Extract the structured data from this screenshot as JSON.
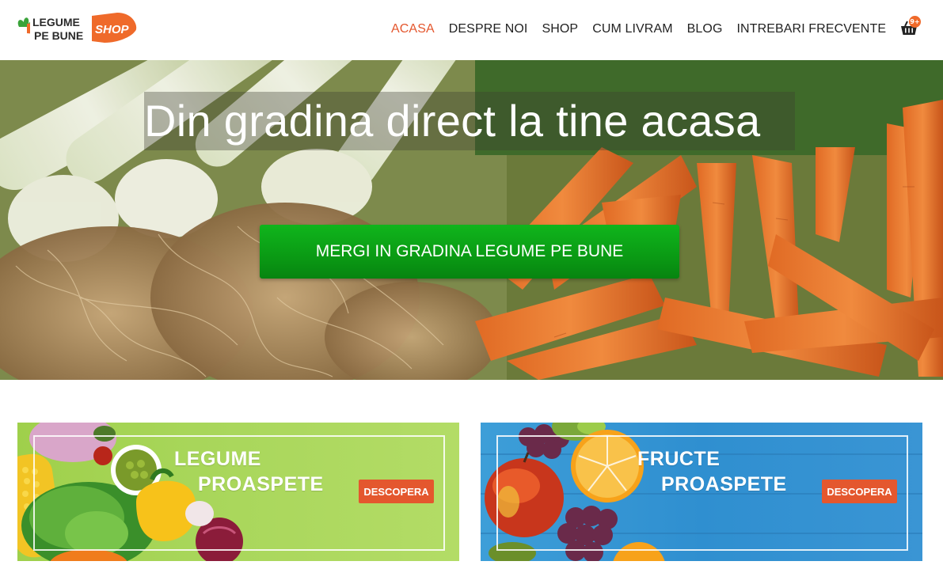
{
  "logo": {
    "line1": "LEGUME",
    "line2": "PE BUNE",
    "shop": "SHOP"
  },
  "nav": {
    "items": [
      {
        "label": "ACASA",
        "active": true
      },
      {
        "label": "DESPRE NOI",
        "active": false
      },
      {
        "label": "SHOP",
        "active": false
      },
      {
        "label": "CUM LIVRAM",
        "active": false
      },
      {
        "label": "BLOG",
        "active": false
      },
      {
        "label": "INTREBARI FRECVENTE",
        "active": false
      }
    ],
    "cart_icon": "basket-icon",
    "cart_badge": "9+"
  },
  "hero": {
    "title": "Din gradina direct la tine acasa",
    "button_label": "MERGI IN GRADINA LEGUME PE BUNE"
  },
  "banners": [
    {
      "line1": "LEGUME",
      "line2": "PROASPETE",
      "button_label": "DESCOPERA"
    },
    {
      "line1": "FRUCTE",
      "line2": "PROASPETE",
      "button_label": "DESCOPERA"
    }
  ],
  "colors": {
    "accent": "#e4572e",
    "hero_button": "#0a9a14",
    "banner_left_bg": "#a8d65a",
    "banner_right_bg": "#2f8fd0"
  }
}
